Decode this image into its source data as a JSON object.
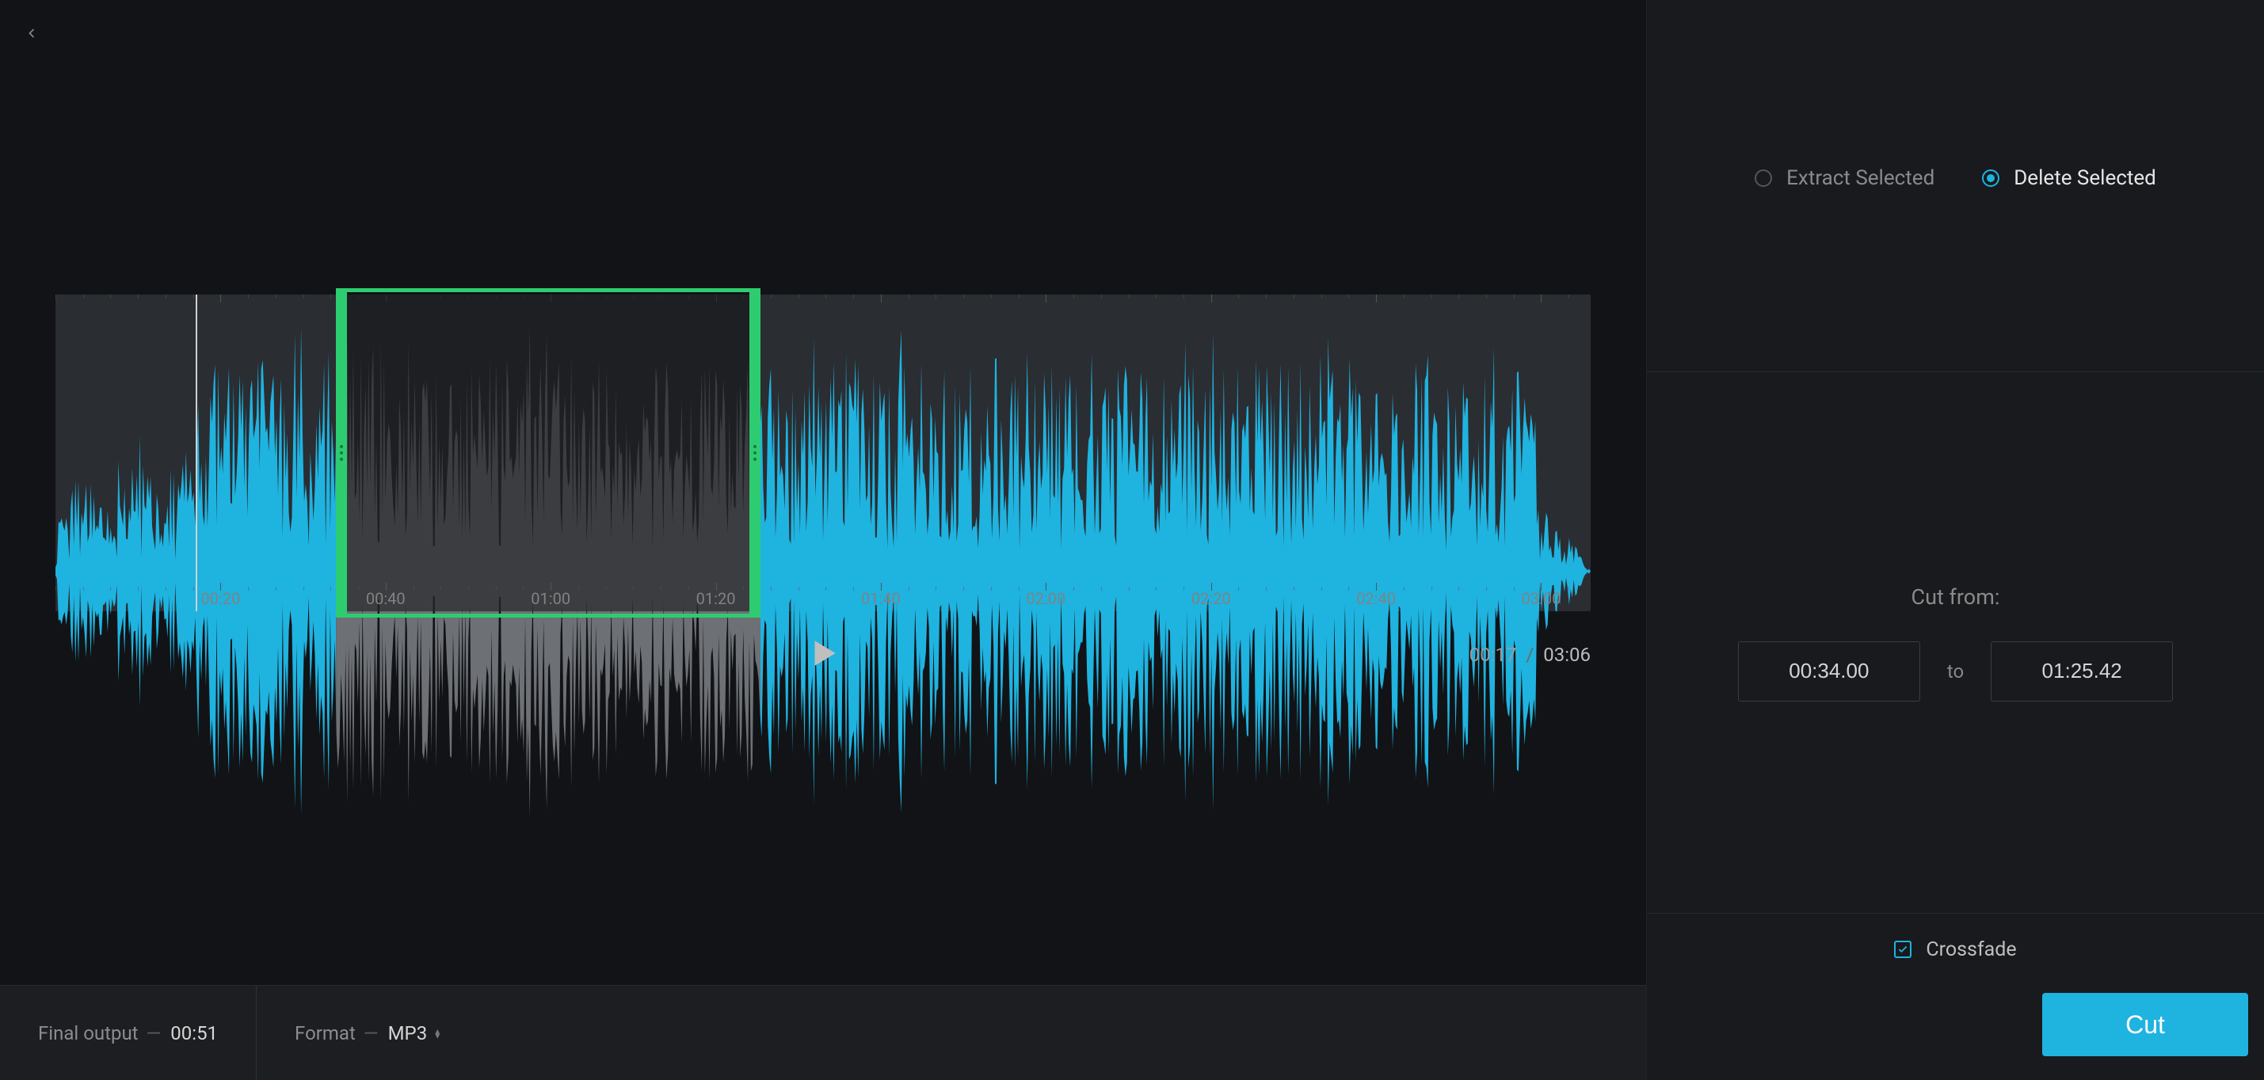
{
  "timeline": {
    "ticks": [
      "00:20",
      "00:40",
      "01:00",
      "01:20",
      "01:40",
      "02:00",
      "02:20",
      "02:40",
      "03:00"
    ],
    "duration_seconds": 186,
    "playhead_seconds": 17,
    "selection_start_seconds": 34.0,
    "selection_end_seconds": 85.42
  },
  "transport": {
    "current_time": "00:17",
    "duration": "03:06",
    "separator": "/"
  },
  "bottom": {
    "final_output_label": "Final output",
    "final_output_value": "00:51",
    "format_label": "Format",
    "format_value": "MP3",
    "dash": "—"
  },
  "sidebar": {
    "mode": {
      "extract_label": "Extract Selected",
      "delete_label": "Delete Selected",
      "selected": "delete"
    },
    "cut": {
      "title": "Cut from:",
      "from_value": "00:34.00",
      "to_label": "to",
      "to_value": "01:25.42"
    },
    "crossfade": {
      "label": "Crossfade",
      "checked": true
    },
    "cut_button": "Cut"
  },
  "colors": {
    "accent": "#1fb3e0",
    "selection": "#2ecc71",
    "wave_active": "#1fb3e0",
    "wave_muted": "#6d7074"
  }
}
